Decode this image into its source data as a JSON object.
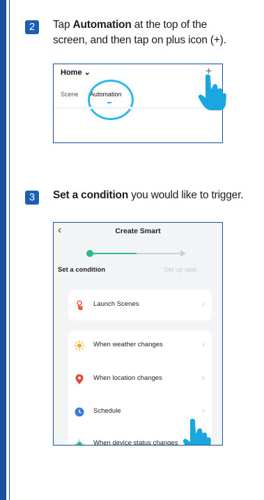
{
  "step2": {
    "number": "2",
    "line1_pre": "Tap ",
    "line1_bold": "Automation",
    "line1_post": " at the top of the",
    "line2": "screen, and then tap on plus icon (+).",
    "screen": {
      "title": "Home ⌄",
      "plus": "+",
      "tab_scene": "Scene",
      "tab_automation": "Automation",
      "tail": "··"
    }
  },
  "step3": {
    "number": "3",
    "bold": "Set a condition",
    "rest": " you would like to trigger.",
    "screen": {
      "back": "‹",
      "title": "Create Smart",
      "label_condition": "Set a condition",
      "label_task": "Set up task",
      "items": [
        {
          "label": "Launch Scenes",
          "icon": "hand-tap-icon",
          "color": "#e8593c"
        },
        {
          "label": "When weather changes",
          "icon": "sun-icon",
          "color": "#f5a623"
        },
        {
          "label": "When location changes",
          "icon": "location-pin-icon",
          "color": "#e8473c"
        },
        {
          "label": "Schedule",
          "icon": "clock-icon",
          "color": "#3b7dd8"
        },
        {
          "label": "When device status changes",
          "icon": "device-icon",
          "color": "#2cba8a"
        }
      ],
      "chevron": "›"
    }
  },
  "colors": {
    "accent": "#1a4f9c",
    "highlight": "#2eb8ea",
    "hand": "#1aa7e0",
    "progress": "#2cba8a"
  }
}
